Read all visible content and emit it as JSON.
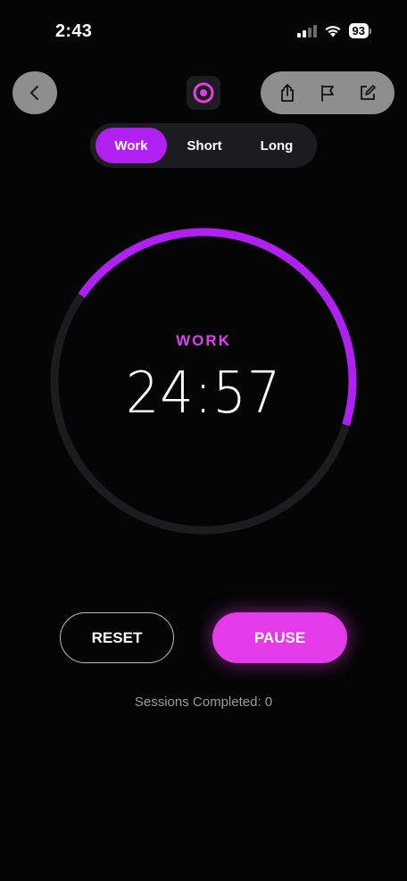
{
  "status_bar": {
    "time": "2:43",
    "battery": "93",
    "icons": [
      "signal-icon",
      "wifi-icon",
      "battery-icon"
    ]
  },
  "toolbar": {
    "back_icon": "chevron-left-icon",
    "logo_icon": "target-icon",
    "actions": [
      "share-icon",
      "flag-icon",
      "edit-icon"
    ]
  },
  "mode_tabs": [
    {
      "label": "Work",
      "active": true
    },
    {
      "label": "Short",
      "active": false
    },
    {
      "label": "Long",
      "active": false
    }
  ],
  "timer": {
    "label": "WORK",
    "display": "24:57",
    "progress_visible_fraction": 0.45
  },
  "controls": {
    "reset_label": "RESET",
    "pause_label": "PAUSE"
  },
  "sessions": {
    "text": "Sessions Completed: 0"
  },
  "colors": {
    "accent_purple": "#b020f0",
    "accent_pink": "#e43be8",
    "ring_track": "#1c1c1e",
    "background": "#050505"
  }
}
